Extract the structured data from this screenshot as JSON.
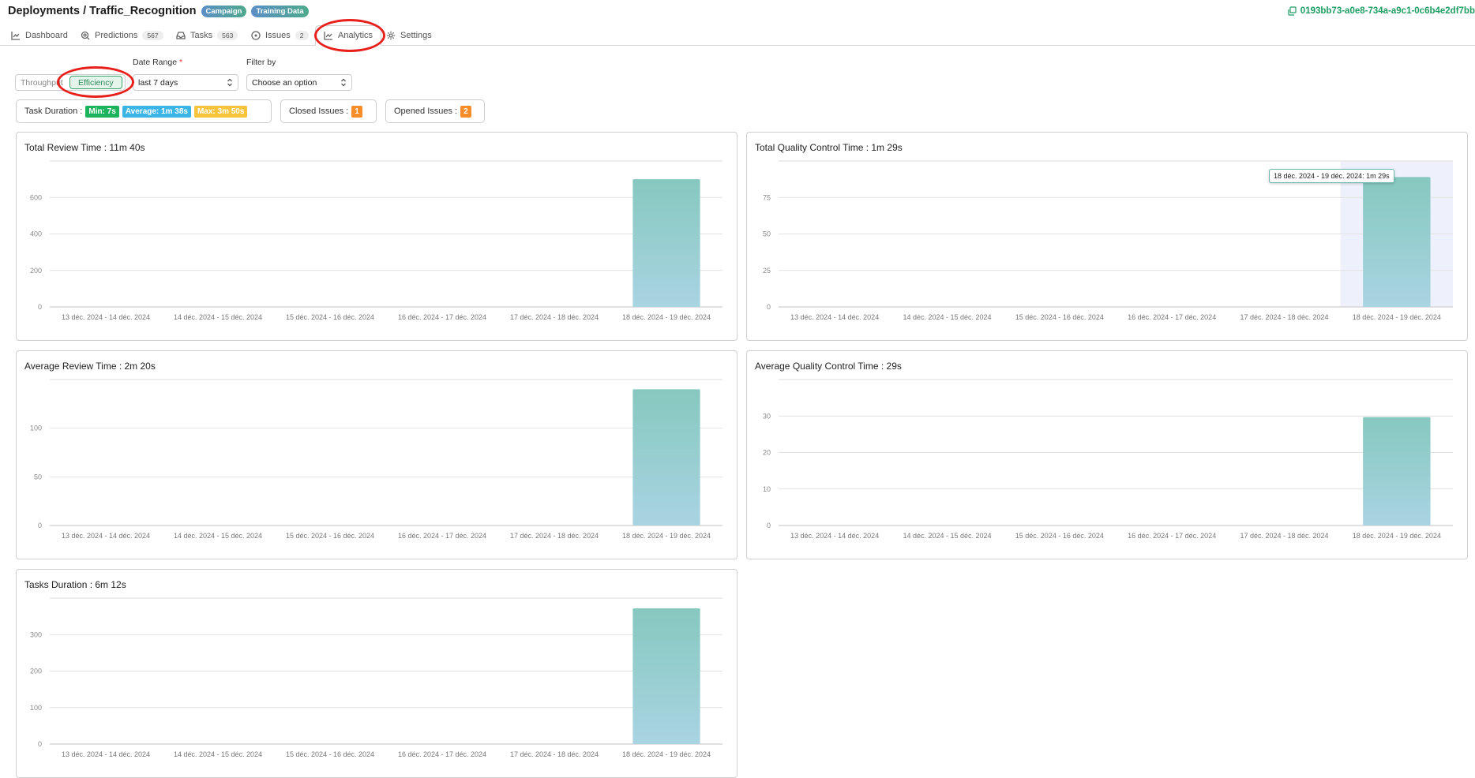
{
  "header": {
    "breadcrumb": "Deployments / Traffic_Recognition",
    "tags": [
      "Campaign",
      "Training Data"
    ],
    "uuid": "0193bb73-a0e8-734a-a9c1-0c6b4e2df7bb",
    "uuid_icon": "copy-icon"
  },
  "nav": {
    "tabs": [
      {
        "label": "Dashboard",
        "icon": "chart-line-icon",
        "badge": null
      },
      {
        "label": "Predictions",
        "icon": "search-icon",
        "badge": "567"
      },
      {
        "label": "Tasks",
        "icon": "inbox-icon",
        "badge": "563"
      },
      {
        "label": "Issues",
        "icon": "circle-dot-icon",
        "badge": "2"
      },
      {
        "label": "Analytics",
        "icon": "chart-line-icon",
        "badge": null,
        "active": true
      },
      {
        "label": "Settings",
        "icon": "gear-icon",
        "badge": null
      }
    ]
  },
  "filters": {
    "view_toggle": {
      "options": [
        "Throughput",
        "Efficiency"
      ],
      "selected": "Efficiency"
    },
    "date_range": {
      "label": "Date Range",
      "required_mark": "*",
      "value": "last 7 days"
    },
    "filter_by": {
      "label": "Filter by",
      "placeholder": "Choose an option"
    }
  },
  "stats": {
    "task_duration_label": "Task Duration :",
    "min": "Min: 7s",
    "average": "Average: 1m 38s",
    "max": "Max: 3m 50s",
    "closed_issues_label": "Closed Issues :",
    "closed_issues_count": "1",
    "opened_issues_label": "Opened Issues :",
    "opened_issues_count": "2"
  },
  "colors": {
    "bar_top": "#86c8bf",
    "bar_bottom": "#a9d4e2",
    "accent_green": "#1f9d63",
    "highlight_band": "#eef0fb"
  },
  "tooltip": {
    "text": "18 déc. 2024 - 19 déc. 2024: 1m 29s"
  },
  "chart_data": [
    {
      "type": "bar",
      "title": "Total Review Time : 11m 40s",
      "categories": [
        "13 déc. 2024 - 14 déc. 2024",
        "14 déc. 2024 - 15 déc. 2024",
        "15 déc. 2024 - 16 déc. 2024",
        "16 déc. 2024 - 17 déc. 2024",
        "17 déc. 2024 - 18 déc. 2024",
        "18 déc. 2024 - 19 déc. 2024"
      ],
      "values": [
        0,
        0,
        0,
        0,
        0,
        700
      ],
      "yticks": [
        0,
        200,
        400,
        600
      ],
      "ylim": [
        0,
        800
      ],
      "xlabel": "",
      "ylabel": "",
      "grid": true
    },
    {
      "type": "bar",
      "title": "Total Quality Control Time : 1m 29s",
      "categories": [
        "13 déc. 2024 - 14 déc. 2024",
        "14 déc. 2024 - 15 déc. 2024",
        "15 déc. 2024 - 16 déc. 2024",
        "16 déc. 2024 - 17 déc. 2024",
        "17 déc. 2024 - 18 déc. 2024",
        "18 déc. 2024 - 19 déc. 2024"
      ],
      "values": [
        0,
        0,
        0,
        0,
        0,
        89
      ],
      "yticks": [
        0,
        25,
        50,
        75
      ],
      "ylim": [
        0,
        100
      ],
      "xlabel": "",
      "ylabel": "",
      "grid": true,
      "highlighted_index": 5
    },
    {
      "type": "bar",
      "title": "Average Review Time : 2m 20s",
      "categories": [
        "13 déc. 2024 - 14 déc. 2024",
        "14 déc. 2024 - 15 déc. 2024",
        "15 déc. 2024 - 16 déc. 2024",
        "16 déc. 2024 - 17 déc. 2024",
        "17 déc. 2024 - 18 déc. 2024",
        "18 déc. 2024 - 19 déc. 2024"
      ],
      "values": [
        0,
        0,
        0,
        0,
        0,
        140
      ],
      "yticks": [
        0,
        50,
        100
      ],
      "ylim": [
        0,
        150
      ],
      "xlabel": "",
      "ylabel": "",
      "grid": true
    },
    {
      "type": "bar",
      "title": "Average Quality Control Time : 29s",
      "categories": [
        "13 déc. 2024 - 14 déc. 2024",
        "14 déc. 2024 - 15 déc. 2024",
        "15 déc. 2024 - 16 déc. 2024",
        "16 déc. 2024 - 17 déc. 2024",
        "17 déc. 2024 - 18 déc. 2024",
        "18 déc. 2024 - 19 déc. 2024"
      ],
      "values": [
        0,
        0,
        0,
        0,
        0,
        29.7
      ],
      "yticks": [
        0,
        10,
        20,
        30
      ],
      "ylim": [
        0,
        40
      ],
      "xlabel": "",
      "ylabel": "",
      "grid": true
    },
    {
      "type": "bar",
      "title": "Tasks Duration : 6m 12s",
      "categories": [
        "13 déc. 2024 - 14 déc. 2024",
        "14 déc. 2024 - 15 déc. 2024",
        "15 déc. 2024 - 16 déc. 2024",
        "16 déc. 2024 - 17 déc. 2024",
        "17 déc. 2024 - 18 déc. 2024",
        "18 déc. 2024 - 19 déc. 2024"
      ],
      "values": [
        0,
        0,
        0,
        0,
        0,
        372
      ],
      "yticks": [
        0,
        100,
        200,
        300
      ],
      "ylim": [
        0,
        400
      ],
      "xlabel": "",
      "ylabel": "",
      "grid": true
    }
  ]
}
